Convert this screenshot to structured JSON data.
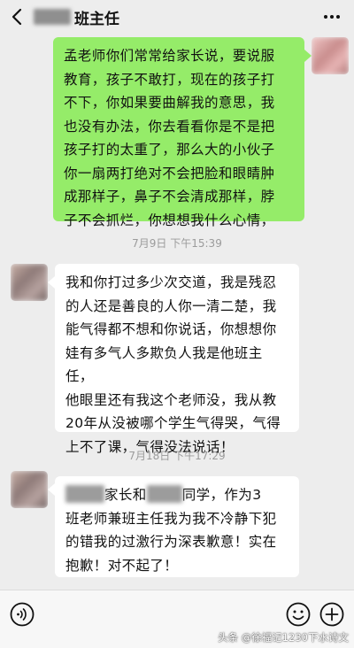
{
  "header": {
    "title": "班主任",
    "back_icon": "chevron-left-icon",
    "more_icon": "more-dots-icon"
  },
  "messages": [
    {
      "side": "right",
      "lines": [
        "孟老师你们常常给家长说，要说服",
        "教育，孩子不敢打，现在的孩子打",
        "不下，你如果要曲解我的意思，我",
        "也没有办法，你去看看你是不是把",
        "孩子打的太重了，那么大的小伙子",
        "你一扇两打绝对不会把脸和眼睛肿",
        "成那样子，鼻子不会清成那样，脖",
        "子不会抓烂，你想想我什么心情，"
      ]
    },
    {
      "side": "left",
      "lines": [
        "我和你打过多少次交道，我是残忍",
        "的人还是善良的人你一清二楚，我",
        "能气得都不想和你说话，你想想你",
        "娃有多气人多欺负人我是他班主任，",
        "他眼里还有我这个老师没，我从教",
        "20年从没被哪个学生气得哭，气得",
        "上不了课，气得没法说话！"
      ]
    },
    {
      "side": "left",
      "line1_a": "家长和",
      "line1_b": "同学，作为3",
      "lines": [
        "班老师兼班主任我为我不冷静下犯",
        "的错我的过激行为深表歉意！实在",
        "抱歉！对不起了！"
      ]
    }
  ],
  "timestamps": [
    "7月9日 下午15:39",
    "7月18日 下午17:29"
  ],
  "input_bar": {
    "voice_icon": "voice-icon",
    "emoji_icon": "emoji-icon",
    "plus_icon": "plus-icon"
  },
  "watermark": "头条 @徐福记1230下水诗文",
  "colors": {
    "my_bubble": "#95ec69",
    "their_bubble": "#ffffff",
    "background": "#ededed"
  }
}
